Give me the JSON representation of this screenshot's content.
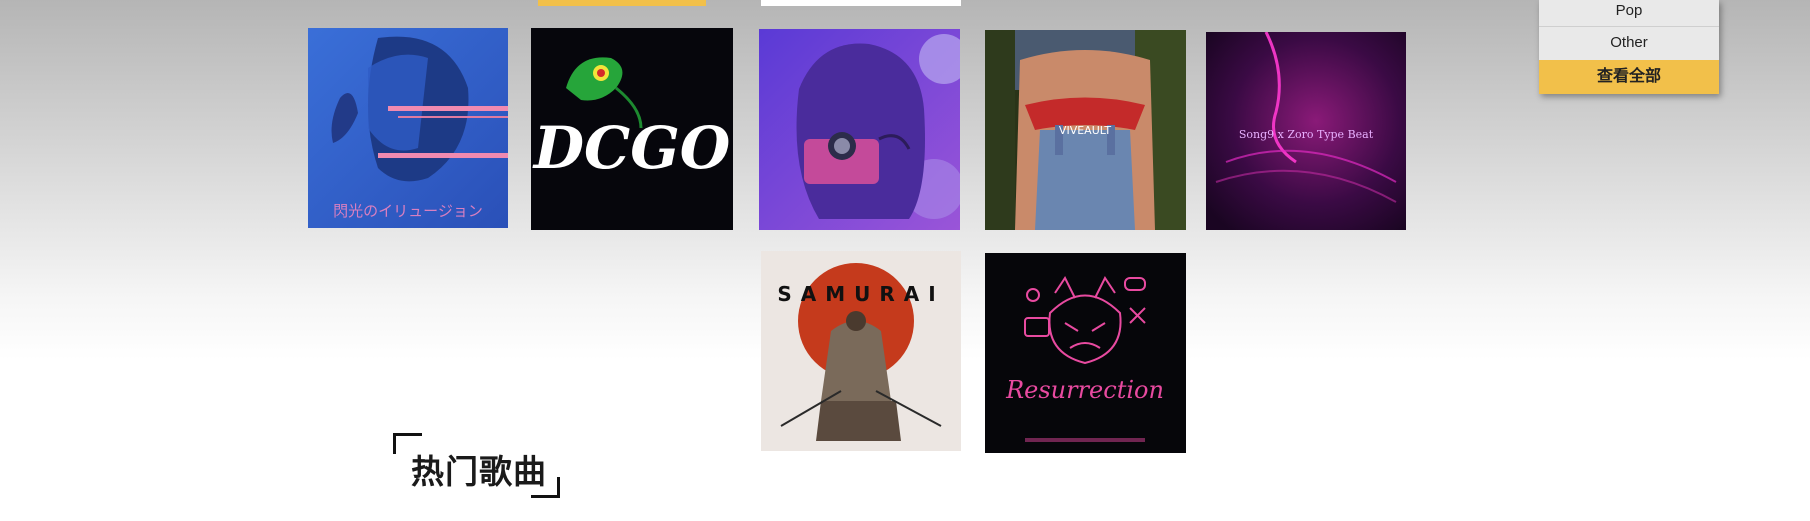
{
  "genre_menu": {
    "items": [
      "Pop",
      "Other"
    ],
    "view_all_label": "查看全部"
  },
  "albums": [
    {
      "name": "闪光のイリュージョン",
      "cover_text": "閃光のイリュージョン"
    },
    {
      "name": "DCGO",
      "cover_text": "DCGO"
    },
    {
      "name": "purple-camera-girl",
      "cover_text": ""
    },
    {
      "name": "VIVEAULT",
      "cover_text": "VIVEAULT"
    },
    {
      "name": "Song9 x Zoro Type Beat",
      "cover_text": "Song9 x Zoro Type Beat"
    },
    {
      "name": "SAMURAI",
      "cover_text": "SAMURAI"
    },
    {
      "name": "Resurrection",
      "cover_text": "Resurrection"
    }
  ],
  "section": {
    "hot_songs_title": "热门歌曲"
  },
  "colors": {
    "accent_yellow": "#f2c04a",
    "menu_bg": "#e9e9e9"
  }
}
